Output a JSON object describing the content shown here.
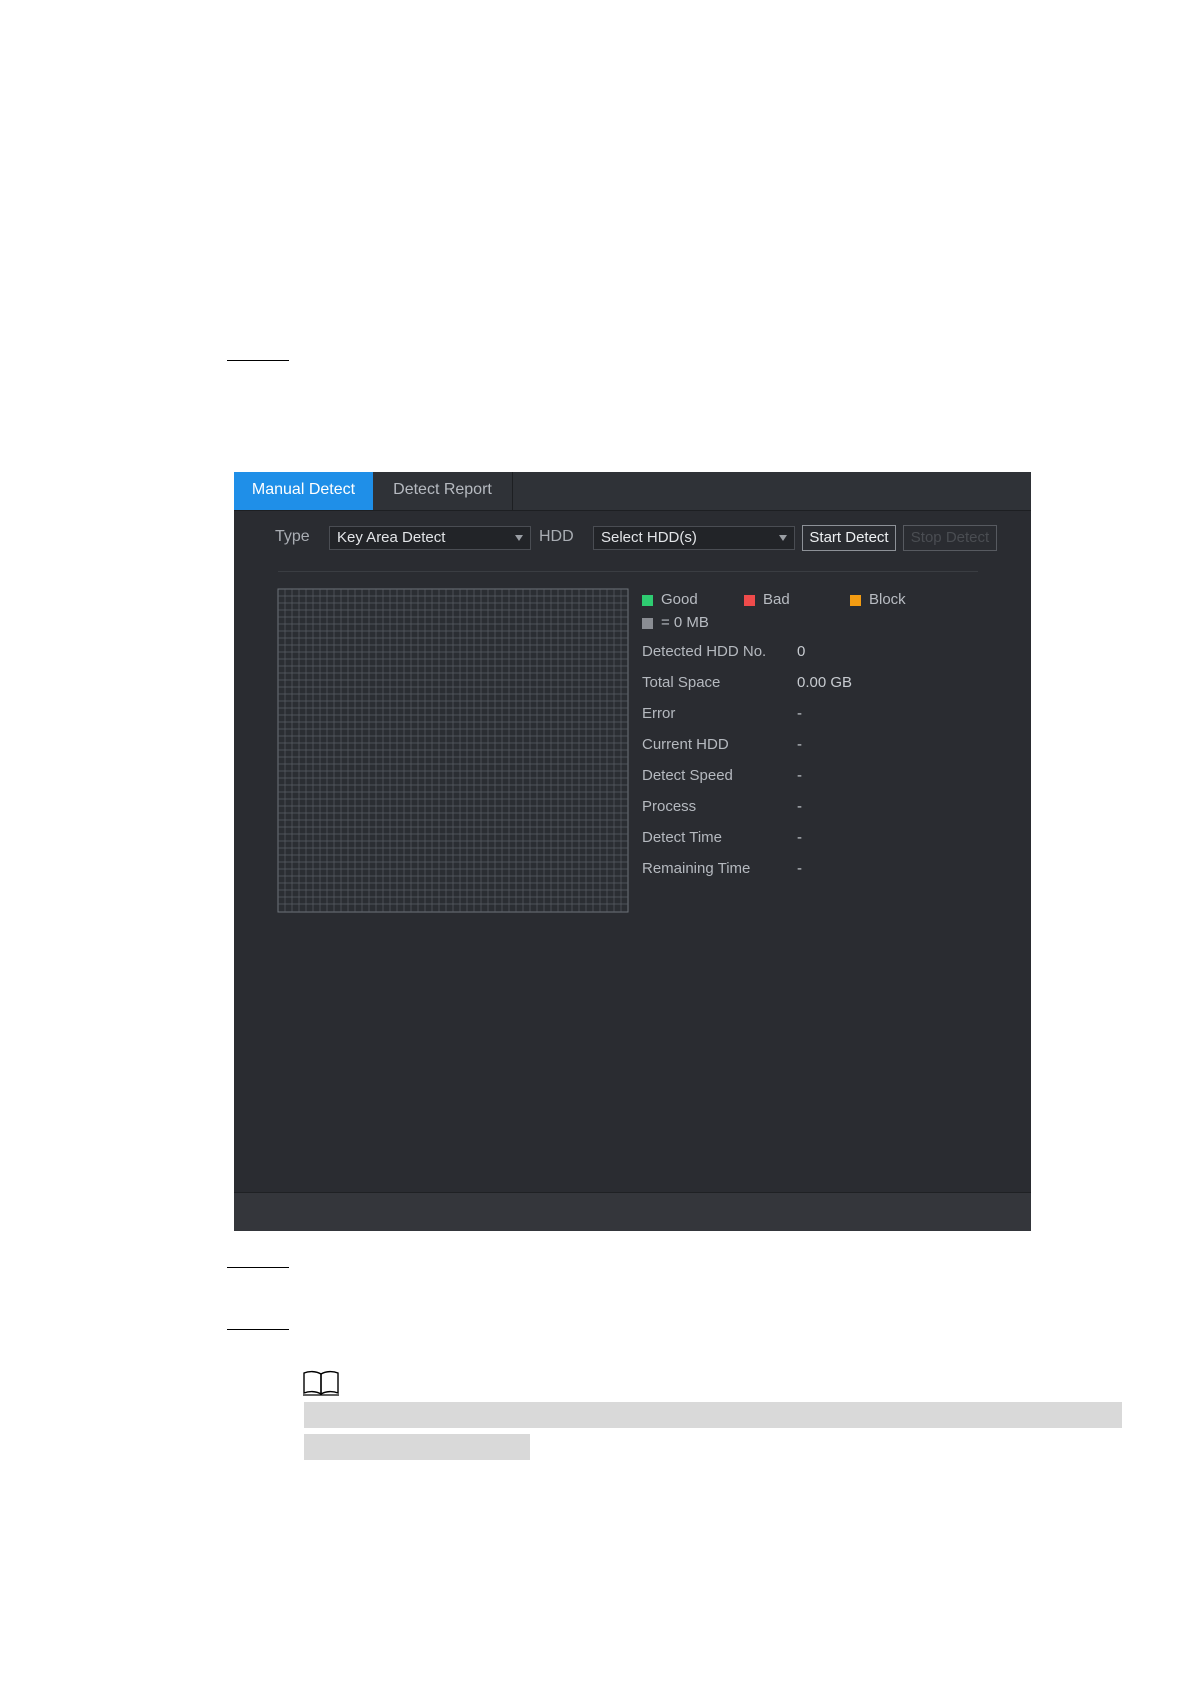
{
  "tabs": [
    {
      "label": "Manual Detect",
      "active": true
    },
    {
      "label": "Detect Report",
      "active": false
    }
  ],
  "toolbar": {
    "type_label": "Type",
    "type_value": "Key Area Detect",
    "hdd_label": "HDD",
    "hdd_value": "Select HDD(s)",
    "start_label": "Start Detect",
    "stop_label": "Stop Detect"
  },
  "legend": {
    "good": {
      "label": "Good",
      "color": "#2ecc71"
    },
    "bad": {
      "label": "Bad",
      "color": "#ef4b4b"
    },
    "block": {
      "label": "Block",
      "color": "#f39c12"
    },
    "unit": {
      "label": "= 0 MB",
      "color": "#8a8d93"
    }
  },
  "info": [
    {
      "label": "Detected HDD No.",
      "value": "0"
    },
    {
      "label": "Total Space",
      "value": "0.00 GB"
    },
    {
      "label": "Error",
      "value": "-"
    },
    {
      "label": "Current HDD",
      "value": "-"
    },
    {
      "label": "Detect Speed",
      "value": "-"
    },
    {
      "label": "Process",
      "value": "-"
    },
    {
      "label": "Detect Time",
      "value": "-"
    },
    {
      "label": "Remaining Time",
      "value": "-"
    }
  ],
  "icons": {
    "note": "book-icon",
    "select_caret": "caret-down-icon"
  }
}
